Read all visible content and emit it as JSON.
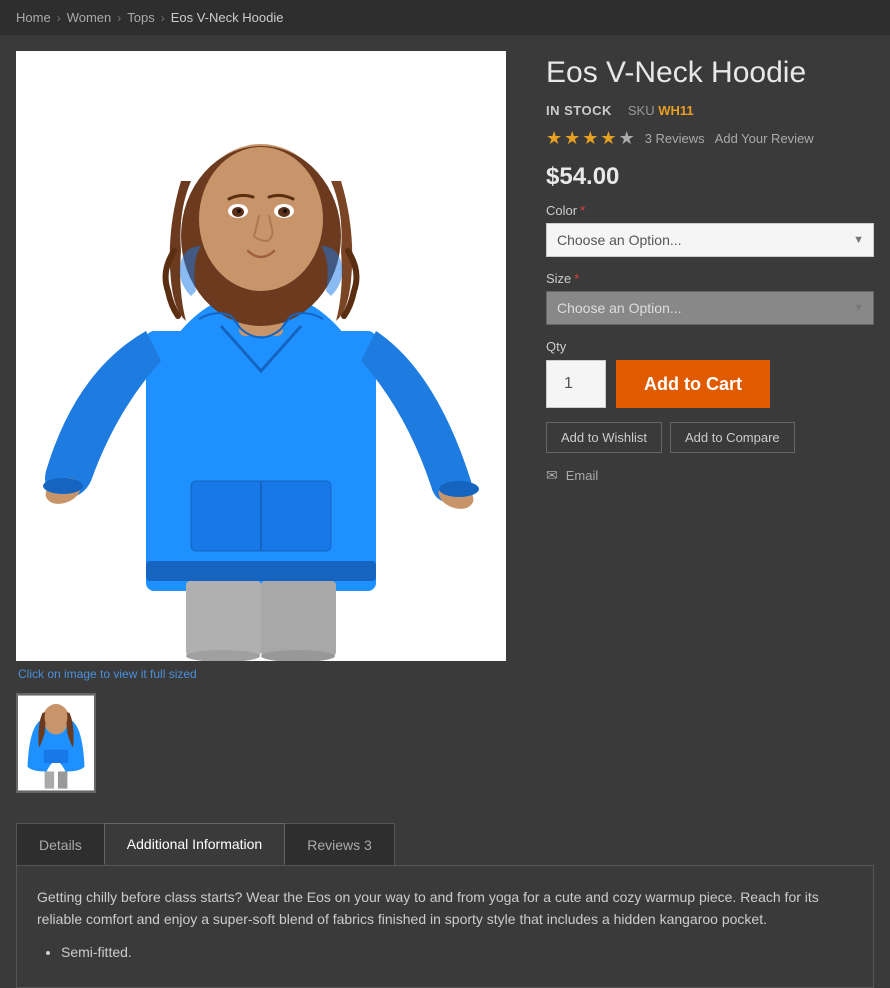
{
  "breadcrumb": {
    "items": [
      {
        "label": "Home",
        "href": "#"
      },
      {
        "label": "Women",
        "href": "#"
      },
      {
        "label": "Tops",
        "href": "#"
      },
      {
        "label": "Eos V-Neck Hoodie",
        "href": "#"
      }
    ]
  },
  "product": {
    "title": "Eos V-Neck Hoodie",
    "stock_status": "IN STOCK",
    "sku_label": "SKU",
    "sku_value": "WH11",
    "stars": 4,
    "reviews_count": "3 Reviews",
    "add_review_label": "Add Your Review",
    "price": "$54.00",
    "color_label": "Color",
    "color_placeholder": "Choose an Option...",
    "size_label": "Size",
    "size_placeholder": "Choose an Option...",
    "qty_label": "Qty",
    "qty_value": "1",
    "add_to_cart_label": "Add to Cart",
    "add_to_wishlist_label": "Add to Wishlist",
    "add_to_compare_label": "Add to Compare",
    "email_label": "Email",
    "click_note": "Click on image to view it full sized"
  },
  "tabs": {
    "items": [
      {
        "id": "details",
        "label": "Details",
        "active": false
      },
      {
        "id": "additional-information",
        "label": "Additional Information",
        "active": true
      },
      {
        "id": "reviews",
        "label": "Reviews 3",
        "active": false
      }
    ],
    "content": "Getting chilly before class starts? Wear the Eos on your way to and from yoga for a cute and cozy warmup piece. Reach for its reliable comfort and enjoy a super-soft blend of fabrics finished in sporty style that includes a hidden kangaroo pocket.",
    "bullet_1": "Semi-fitted."
  },
  "colors": {
    "star": "#e8a020",
    "add_to_cart": "#e05a00",
    "sku": "#e8a020",
    "link_blue": "#4a90d9"
  }
}
